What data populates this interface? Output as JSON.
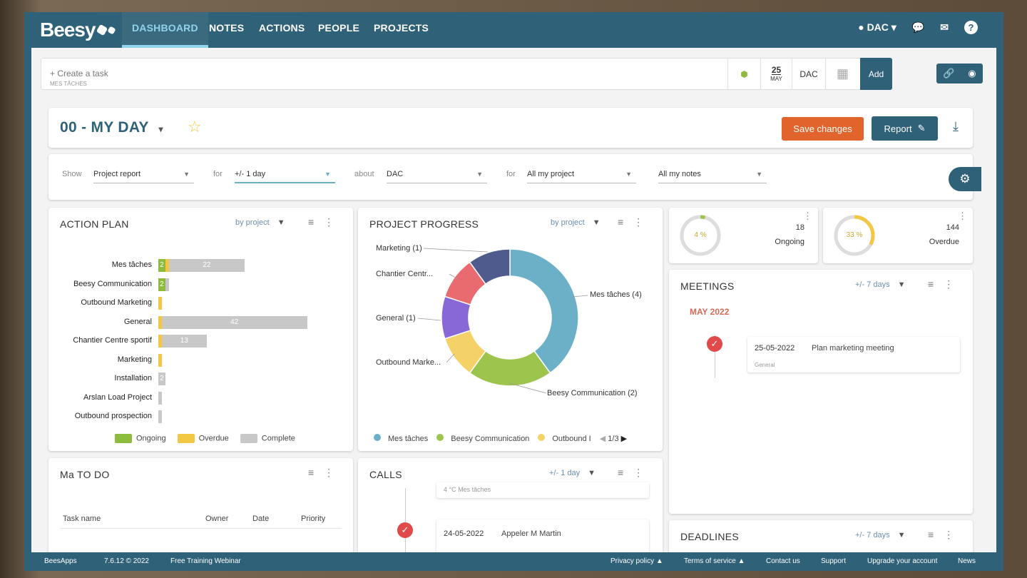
{
  "nav": {
    "logo": "Beesy",
    "items": [
      "DASHBOARD",
      "NOTES",
      "ACTIONS",
      "PEOPLE",
      "PROJECTS"
    ],
    "user": "DAC"
  },
  "taskbar": {
    "placeholder": "+ Create a task",
    "sublabel": "MES TÂCHES",
    "day": "25",
    "month": "MAY",
    "owner": "DAC",
    "add": "Add"
  },
  "page": {
    "title": "00 - MY DAY",
    "save": "Save changes",
    "report": "Report"
  },
  "filters": {
    "show_label": "Show",
    "show": "Project report",
    "for_label": "for",
    "for": "+/- 1 day",
    "about_label": "about",
    "about": "DAC",
    "for2_label": "for",
    "project": "All my project",
    "notes": "All my notes"
  },
  "action_plan": {
    "title": "ACTION PLAN",
    "by": "by project",
    "legend": [
      "Ongoing",
      "Overdue",
      "Complete"
    ]
  },
  "project_progress": {
    "title": "PROJECT PROGRESS",
    "by": "by project",
    "legend": [
      "Mes tâches",
      "Beesy Communication",
      "Outbound I"
    ],
    "page": "1/3",
    "labels": [
      "Marketing (1)",
      "Chantier Centr...",
      "General (1)",
      "Outbound Marke...",
      "Mes tâches (4)",
      "Beesy Communication (2)"
    ]
  },
  "kpis": [
    {
      "pct": "4 %",
      "value": "18",
      "label": "Ongoing"
    },
    {
      "pct": "33 %",
      "value": "144",
      "label": "Overdue"
    }
  ],
  "meetings": {
    "title": "MEETINGS",
    "range": "+/- 7 days",
    "month": "MAY 2022",
    "date": "25-05-2022",
    "name": "Plan marketing meeting",
    "project": "General"
  },
  "todo": {
    "title": "Ma TO DO",
    "cols": [
      "Task name",
      "Owner",
      "Date",
      "Priority"
    ]
  },
  "calls": {
    "title": "CALLS",
    "range": "+/- 1 day",
    "prev": "4 °C Mes tâches",
    "date": "24-05-2022",
    "name": "Appeler M Martin"
  },
  "deadlines": {
    "title": "DEADLINES",
    "range": "+/- 7 days"
  },
  "footer": {
    "brand": "BeesApps",
    "version": "7.6.12 © 2022",
    "webinar": "Free Training Webinar",
    "privacy": "Privacy policy ▲",
    "terms": "Terms of service ▲",
    "contact": "Contact us",
    "support": "Support",
    "upgrade": "Upgrade your account",
    "news": "News"
  },
  "chart_data": [
    {
      "type": "bar",
      "title": "ACTION PLAN",
      "categories": [
        "Mes tâches",
        "Beesy Communication",
        "Outbound Marketing",
        "General",
        "Chantier Centre sportif",
        "Marketing",
        "Installation",
        "Arslan Load Project",
        "Outbound prospection"
      ],
      "series": [
        {
          "name": "Ongoing",
          "values": [
            2,
            2,
            0,
            0,
            0,
            0,
            0,
            0,
            0
          ]
        },
        {
          "name": "Overdue",
          "values": [
            1,
            0,
            1,
            1,
            1,
            1,
            0,
            0,
            0
          ]
        },
        {
          "name": "Complete",
          "values": [
            22,
            1,
            0,
            42,
            13,
            0,
            2,
            1,
            1
          ]
        }
      ],
      "colors": [
        "#8dbb3c",
        "#f3c744",
        "#c8c8c8"
      ]
    },
    {
      "type": "pie",
      "title": "PROJECT PROGRESS",
      "categories": [
        "Mes tâches",
        "Beesy Communication",
        "Outbound Marketing",
        "General",
        "Chantier Centre sportif",
        "Marketing"
      ],
      "values": [
        4,
        2,
        1,
        1,
        1,
        1
      ],
      "colors": [
        "#6bb0c7",
        "#9dc44d",
        "#f4d268",
        "#8868d6",
        "#ea6b6f",
        "#4f5b8c"
      ]
    }
  ]
}
